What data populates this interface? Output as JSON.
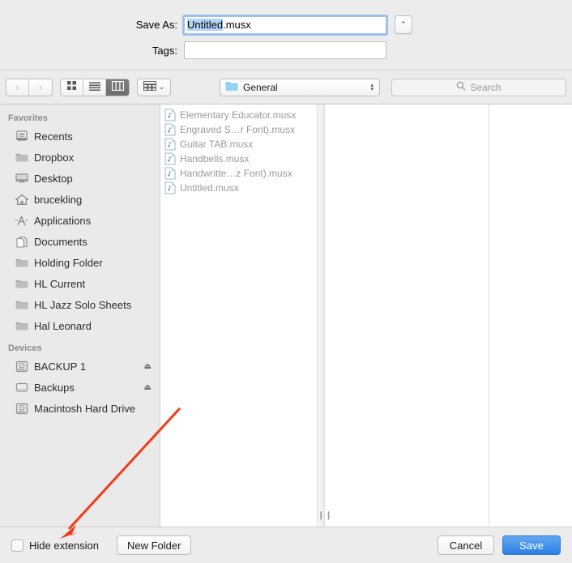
{
  "header": {
    "save_as_label": "Save As:",
    "save_as_value_selected": "Untitled",
    "save_as_value_rest": ".musx",
    "tags_label": "Tags:",
    "tags_value": "",
    "disclosure_glyph": "⌃"
  },
  "toolbar": {
    "back_glyph": "‹",
    "forward_glyph": "›",
    "arrange_chevron": "⌄",
    "path_popup_label": "General",
    "path_popup_up": "▴",
    "path_popup_down": "▾",
    "search_placeholder": "Search",
    "search_value": ""
  },
  "sidebar": {
    "sections": [
      {
        "title": "Favorites",
        "items": [
          {
            "label": "Recents",
            "icon": "recents-icon",
            "eject": false
          },
          {
            "label": "Dropbox",
            "icon": "folder-icon",
            "eject": false
          },
          {
            "label": "Desktop",
            "icon": "desktop-icon",
            "eject": false
          },
          {
            "label": "brucekling",
            "icon": "home-icon",
            "eject": false
          },
          {
            "label": "Applications",
            "icon": "applications-icon",
            "eject": false
          },
          {
            "label": "Documents",
            "icon": "documents-icon",
            "eject": false
          },
          {
            "label": " Holding Folder",
            "icon": "folder-icon",
            "eject": false
          },
          {
            "label": "HL Current",
            "icon": "folder-icon",
            "eject": false
          },
          {
            "label": " HL Jazz Solo Sheets",
            "icon": "folder-icon",
            "eject": false
          },
          {
            "label": "Hal Leonard",
            "icon": "folder-icon",
            "eject": false
          }
        ]
      },
      {
        "title": "Devices",
        "items": [
          {
            "label": "BACKUP 1",
            "icon": "external-drive-icon",
            "eject": true
          },
          {
            "label": "Backups",
            "icon": "drive-icon",
            "eject": true
          },
          {
            "label": "Macintosh Hard Drive",
            "icon": "external-drive-icon",
            "eject": false
          }
        ]
      }
    ],
    "eject_glyph": "⏏"
  },
  "files": {
    "items": [
      {
        "name": "Elementary Educator.musx"
      },
      {
        "name": "Engraved S…r Font).musx"
      },
      {
        "name": "Guitar TAB.musx"
      },
      {
        "name": "Handbells.musx"
      },
      {
        "name": "Handwritte…z Font).musx"
      },
      {
        "name": "Untitled.musx"
      }
    ],
    "resize_grip": "❙❙"
  },
  "footer": {
    "hide_extension_label": "Hide extension",
    "hide_extension_checked": false,
    "new_folder_label": "New Folder",
    "cancel_label": "Cancel",
    "save_label": "Save"
  },
  "colors": {
    "accent_blue": "#2d80e8",
    "selection_blue": "#b4d5fa",
    "annotation_red": "#f23a15",
    "window_bg": "#ececec",
    "sidebar_bg": "#eaeaea"
  }
}
